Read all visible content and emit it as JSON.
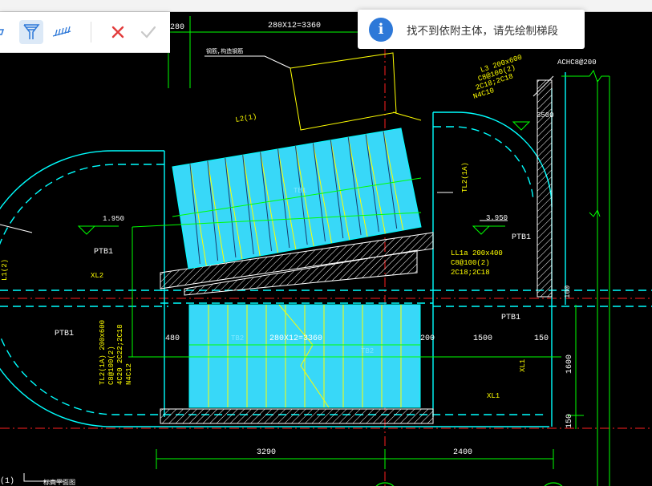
{
  "toolbar": {
    "tools": [
      {
        "name": "draw-line-tool",
        "icon": "line-draw-icon"
      },
      {
        "name": "stair-tool",
        "icon": "stair-icon",
        "active": true
      },
      {
        "name": "hatch-tool",
        "icon": "hatch-icon"
      }
    ],
    "cancel_icon": "close-icon",
    "confirm_icon": "check-icon"
  },
  "toast": {
    "icon": "info-icon",
    "icon_glyph": "i",
    "message": "找不到依附主体，请先绘制梯段"
  },
  "drawing": {
    "dim_top_left": "280",
    "dim_top": "280X12=3360",
    "label_steel": "钢筋,构造钢筋",
    "label_rebar_top": "ACHC8@200",
    "label_L3": "L3 200x600",
    "label_L3_s1": "C8@100(2)",
    "label_L3_s2": "2C18;2C18",
    "label_L3_s3": "N4C10",
    "dim_3500": "3500",
    "label_L2": "L2(1)",
    "label_TB1": "TB1",
    "label_TL2": "TL2(1A)",
    "elev_1950": "1.950",
    "elev_3950": "3.950",
    "label_PTB1_a": "PTB1",
    "label_PTB1_b": "PTB1",
    "label_PTB1_c": "PTB1",
    "label_PTB1_d": "PTB1",
    "label_XL2": "XL2",
    "label_LL1a": "LL1a 200x400",
    "label_LL1a_s1": "C8@100(2)",
    "label_LL1a_s2": "2C18;2C18",
    "dim_480": "480",
    "dim_mid": "280X12=3360",
    "dim_200": "200",
    "dim_1500": "1500",
    "dim_150a": "150",
    "label_TB2": "TB2",
    "label_TB2b": "TB2",
    "label_TL2b": "TL2(1A) 200x600",
    "label_TL2b_s1": "C8@100(2)",
    "label_TL2b_s2": "4C20 2C22;2C18",
    "label_TL2b_s3": "N4C12",
    "label_XL1a": "XL1",
    "label_XL1b": "XL1",
    "dim_1600": "1600",
    "dim_150b": "150",
    "dim_100": "100",
    "dim_3290": "3290",
    "dim_2400": "2400",
    "label_left_side": "L1(2)",
    "bottom_note": "标高平面图",
    "bottom_left": "(1)"
  },
  "colors": {
    "cyan": "#00ffff",
    "tread_fill": "#38d8f8",
    "green": "#00ff00",
    "red": "#ff2020",
    "yellow": "#ffff00",
    "white": "#ffffff",
    "accent": "#2d78d8",
    "cancel": "#e23b3b"
  }
}
